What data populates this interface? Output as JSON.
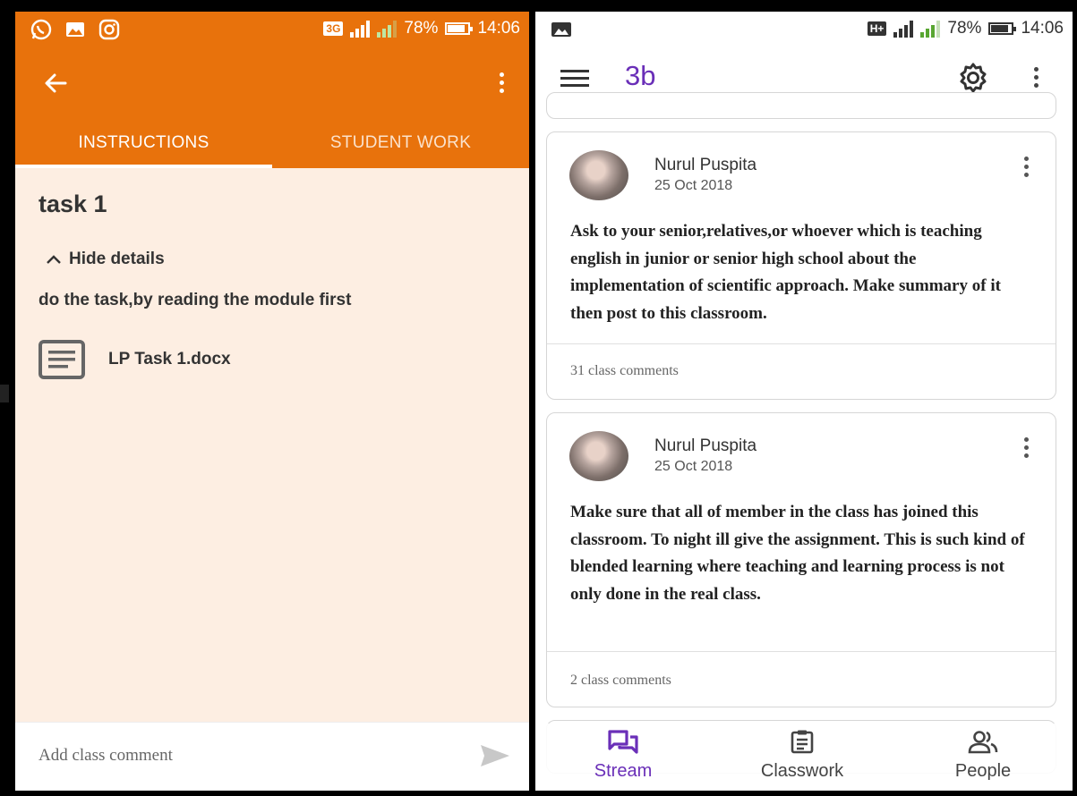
{
  "left_screen": {
    "status": {
      "network": "3G",
      "battery": "78%",
      "time": "14:06"
    },
    "tabs": [
      {
        "label": "INSTRUCTIONS",
        "active": true
      },
      {
        "label": "STUDENT WORK",
        "active": false
      }
    ],
    "task": {
      "title": "task 1",
      "hide_details": "Hide details",
      "description": "do the task,by reading the module first",
      "attachment": "LP Task 1.docx"
    },
    "comment": {
      "placeholder": "Add class comment"
    },
    "colors": {
      "accent": "#e8720c",
      "background": "#fdeee2"
    }
  },
  "right_screen": {
    "status": {
      "network": "H+",
      "battery": "78%",
      "time": "14:06"
    },
    "class_title": "3b",
    "posts": [
      {
        "author": "Nurul Puspita",
        "date": "25 Oct 2018",
        "body": "Ask to your senior,relatives,or whoever which is teaching english in junior or senior high school about the implementation of scientific approach. Make summary  of it then post to this classroom.",
        "comments": "31 class comments"
      },
      {
        "author": "Nurul Puspita",
        "date": "25 Oct 2018",
        "body": "Make sure that all of member in the class has joined this classroom. To night ill give the assignment. This is such kind of blended learning where teaching and learning process is not only done in the real class.",
        "comments": "2 class comments"
      }
    ],
    "bottom_nav": [
      {
        "label": "Stream",
        "icon": "stream-icon",
        "active": true
      },
      {
        "label": "Classwork",
        "icon": "classwork-icon",
        "active": false
      },
      {
        "label": "People",
        "icon": "people-icon",
        "active": false
      }
    ],
    "colors": {
      "accent": "#6a2fb8"
    }
  }
}
